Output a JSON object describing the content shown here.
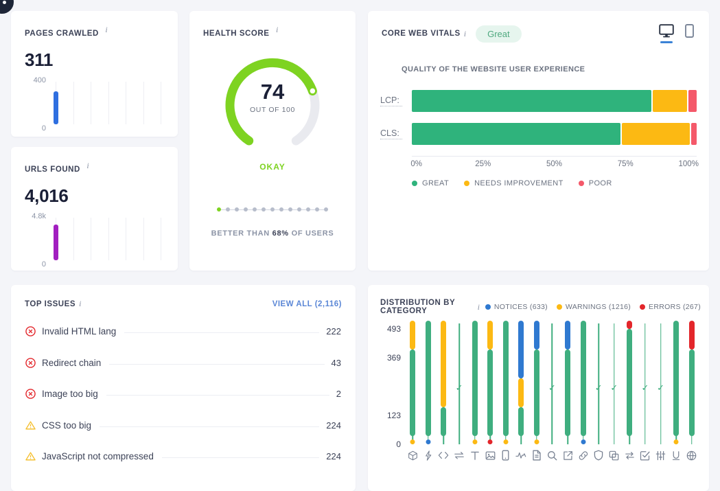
{
  "pages_crawled": {
    "title": "PAGES CRAWLED",
    "info_icon": "info-icon",
    "value": "311",
    "axis_top": "400",
    "axis_bottom": "0",
    "bar_color": "#2f6fe0",
    "bar_ratio": 0.78
  },
  "urls_found": {
    "title": "URLS FOUND",
    "info_icon": "info-icon",
    "value": "4,016",
    "axis_top": "4.8k",
    "axis_bottom": "0",
    "bar_color": "#a21fc0",
    "bar_ratio": 0.84
  },
  "health_score": {
    "title": "HEALTH SCORE",
    "info_icon": "info-icon",
    "score": "74",
    "out_of": "OUT OF 100",
    "verdict": "OKAY",
    "verdict_color": "#7ed321",
    "arc_color": "#7ed321",
    "better_than_prefix": "BETTER THAN",
    "better_than_value": "68%",
    "better_than_suffix": "OF USERS",
    "progress_steps": 13,
    "progress_active": 1
  },
  "core_web_vitals": {
    "title": "CORE WEB VITALS",
    "info_icon": "info-icon",
    "badge": "Great",
    "badge_bg": "#e6f5ee",
    "badge_color": "#4fa97f",
    "devices": [
      {
        "name": "desktop-monitor-icon",
        "selected": true
      },
      {
        "name": "mobile-phone-icon",
        "selected": false
      }
    ],
    "subtitle": "QUALITY OF THE WEBSITE USER EXPERIENCE",
    "metrics": [
      {
        "label": "LCP:",
        "great": 85,
        "needs": 12,
        "poor": 3
      },
      {
        "label": "CLS:",
        "great": 74,
        "needs": 24,
        "poor": 2
      }
    ],
    "axis_ticks": [
      "0%",
      "25%",
      "50%",
      "75%",
      "100%"
    ],
    "legend": [
      {
        "label": "GREAT",
        "color": "#2fb37c"
      },
      {
        "label": "NEEDS IMPROVEMENT",
        "color": "#fcb913"
      },
      {
        "label": "POOR",
        "color": "#f4596a"
      }
    ]
  },
  "top_issues": {
    "title": "TOP ISSUES",
    "info_icon": "info-icon",
    "view_all": "VIEW ALL (2,116)",
    "rows": [
      {
        "severity": "error",
        "icon": "error-circle-x-icon",
        "name": "Invalid HTML lang",
        "count": "222"
      },
      {
        "severity": "error",
        "icon": "error-circle-x-icon",
        "name": "Redirect chain",
        "count": "43"
      },
      {
        "severity": "error",
        "icon": "error-circle-x-icon",
        "name": "Image too big",
        "count": "2"
      },
      {
        "severity": "warning",
        "icon": "warning-triangle-icon",
        "name": "CSS too big",
        "count": "224"
      },
      {
        "severity": "warning",
        "icon": "warning-triangle-icon",
        "name": "JavaScript not compressed",
        "count": "224"
      }
    ],
    "error_color": "#e3262b",
    "warning_color": "#f5c033"
  },
  "chart_data": {
    "type": "bar",
    "title": "DISTRIBUTION BY CATEGORY",
    "info_icon": "info-icon",
    "stacked": true,
    "grid": false,
    "legend_position": "top-right",
    "ylabel": "",
    "xlabel": "",
    "ylim": [
      0,
      493
    ],
    "yticks": [
      493,
      369,
      123,
      0
    ],
    "legend": [
      {
        "name": "NOTICES",
        "label": "NOTICES (633)",
        "color": "#2f79d0",
        "total": 633
      },
      {
        "name": "WARNINGS",
        "label": "WARNINGS (1216)",
        "color": "#fcb913",
        "total": 1216
      },
      {
        "name": "ERRORS",
        "label": "ERRORS (267)",
        "color": "#e3262b",
        "total": 267
      }
    ],
    "categories": [
      "3d-box-icon",
      "lightning-bolt-icon",
      "code-brackets-icon",
      "redirect-arrows-icon",
      "text-t-icon",
      "image-icon",
      "mobile-icon",
      "activity-pulse-icon",
      "document-icon",
      "search-icon",
      "external-link-icon",
      "link-chain-icon",
      "shield-icon",
      "copy-icon",
      "refresh-cycle-icon",
      "checkbox-icon",
      "sliders-icon",
      "underline-u-icon",
      "globe-icon"
    ],
    "columns": [
      {
        "category": "3d-box-icon",
        "great": 370,
        "warnings": 123,
        "notices": 0,
        "errors": 0,
        "dot": "warnings",
        "empty": false
      },
      {
        "category": "lightning-bolt-icon",
        "great": 493,
        "warnings": 0,
        "notices": 0,
        "errors": 0,
        "dot": "notices",
        "empty": false
      },
      {
        "category": "code-brackets-icon",
        "great": 123,
        "warnings": 370,
        "notices": 0,
        "errors": 0,
        "dot": "none",
        "empty": false
      },
      {
        "category": "redirect-arrows-icon",
        "great": 0,
        "warnings": 0,
        "notices": 0,
        "errors": 0,
        "dot": "none",
        "empty": true
      },
      {
        "category": "text-t-icon",
        "great": 493,
        "warnings": 0,
        "notices": 0,
        "errors": 0,
        "dot": "warnings",
        "empty": false
      },
      {
        "category": "image-icon",
        "great": 370,
        "warnings": 123,
        "notices": 0,
        "errors": 0,
        "dot": "errors",
        "empty": false
      },
      {
        "category": "mobile-icon",
        "great": 493,
        "warnings": 0,
        "notices": 0,
        "errors": 0,
        "dot": "warnings",
        "empty": false
      },
      {
        "category": "activity-pulse-icon",
        "great": 123,
        "warnings": 123,
        "notices": 247,
        "errors": 0,
        "dot": "none",
        "empty": false
      },
      {
        "category": "document-icon",
        "great": 370,
        "warnings": 0,
        "notices": 123,
        "errors": 0,
        "dot": "warnings",
        "empty": false
      },
      {
        "category": "search-icon",
        "great": 0,
        "warnings": 0,
        "notices": 0,
        "errors": 0,
        "dot": "none",
        "empty": true
      },
      {
        "category": "external-link-icon",
        "great": 370,
        "warnings": 0,
        "notices": 123,
        "errors": 0,
        "dot": "none",
        "empty": false
      },
      {
        "category": "link-chain-icon",
        "great": 493,
        "warnings": 0,
        "notices": 0,
        "errors": 0,
        "dot": "notices",
        "empty": false
      },
      {
        "category": "shield-icon",
        "great": 0,
        "warnings": 0,
        "notices": 0,
        "errors": 0,
        "dot": "none",
        "empty": true
      },
      {
        "category": "copy-icon",
        "great": 0,
        "warnings": 0,
        "notices": 0,
        "errors": 0,
        "dot": "none",
        "empty": true
      },
      {
        "category": "refresh-cycle-icon",
        "great": 458,
        "warnings": 0,
        "notices": 0,
        "errors": 35,
        "dot": "none",
        "empty": false
      },
      {
        "category": "checkbox-icon",
        "great": 0,
        "warnings": 0,
        "notices": 0,
        "errors": 0,
        "dot": "none",
        "empty": true
      },
      {
        "category": "sliders-icon",
        "great": 0,
        "warnings": 0,
        "notices": 0,
        "errors": 0,
        "dot": "none",
        "empty": true
      },
      {
        "category": "underline-u-icon",
        "great": 493,
        "warnings": 0,
        "notices": 0,
        "errors": 0,
        "dot": "warnings",
        "empty": false
      },
      {
        "category": "globe-icon",
        "great": 370,
        "warnings": 0,
        "notices": 0,
        "errors": 123,
        "dot": "none",
        "empty": false
      }
    ],
    "checkmarks": [
      3,
      9,
      12,
      13,
      15,
      16
    ]
  }
}
